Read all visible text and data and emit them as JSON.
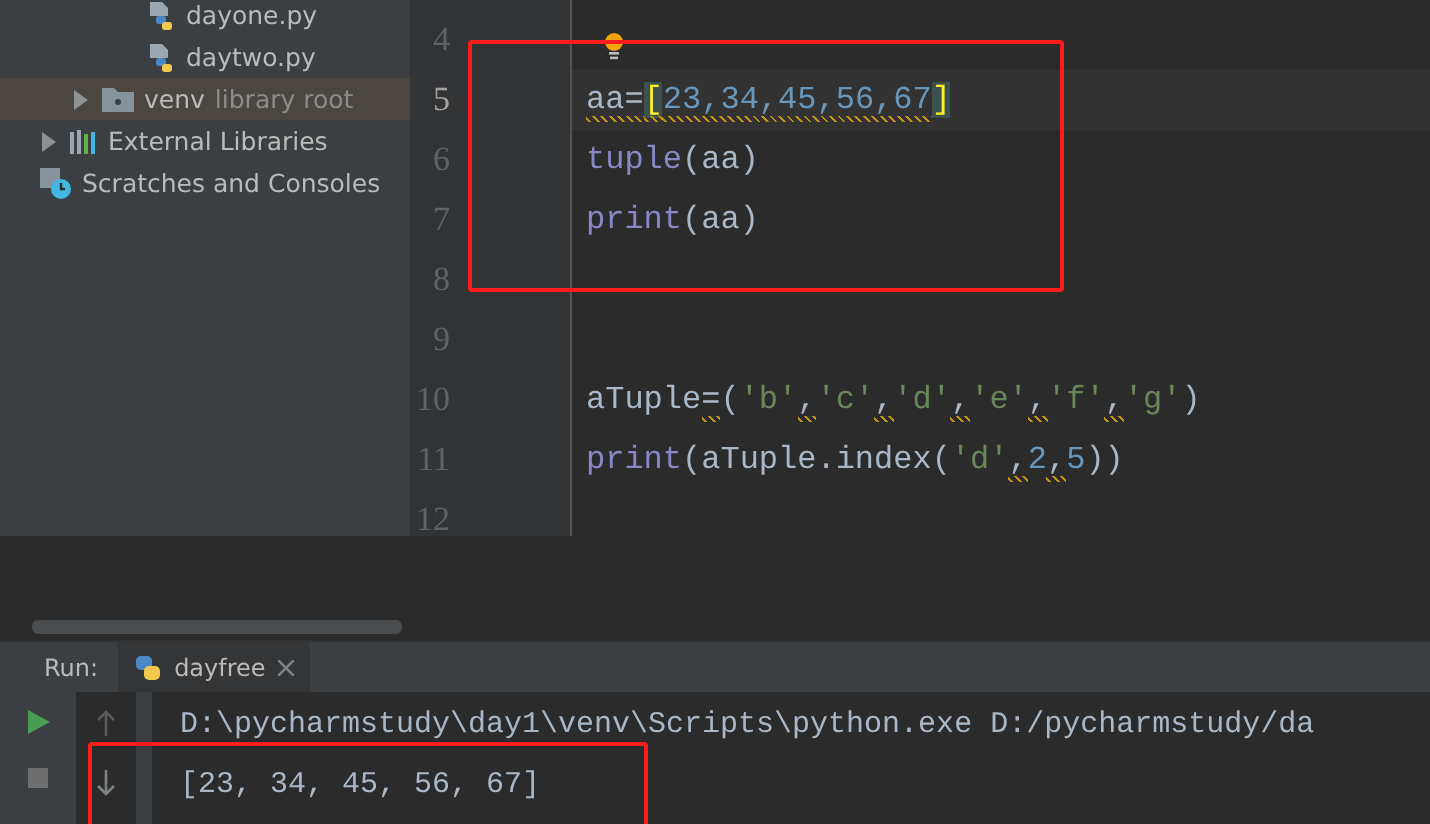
{
  "project_tree": {
    "items": [
      {
        "label": "dayone.py",
        "kind": "python-file",
        "selected": false
      },
      {
        "label": "daytwo.py",
        "kind": "python-file",
        "selected": false
      },
      {
        "label": "venv",
        "suffix": "library root",
        "kind": "folder",
        "selected": true,
        "expanded": false
      },
      {
        "label": "External Libraries",
        "kind": "libraries",
        "selected": false,
        "expanded": false
      },
      {
        "label": "Scratches and Consoles",
        "kind": "scratches",
        "selected": false
      }
    ]
  },
  "editor": {
    "lines": [
      {
        "number": "4",
        "current": false,
        "highlighted": false,
        "intention_bulb": true
      },
      {
        "number": "5",
        "current": true,
        "highlighted": true,
        "tokens": [
          {
            "text": "aa=",
            "kind": "plain",
            "warning": true
          },
          {
            "text": "[",
            "kind": "bracket-match",
            "warning": true
          },
          {
            "text": "23,34,45,56,67",
            "kind": "number",
            "warning": true
          },
          {
            "text": "]",
            "kind": "bracket-match"
          }
        ]
      },
      {
        "number": "6",
        "current": false,
        "highlighted": true,
        "tokens": [
          {
            "text": "tuple",
            "kind": "builtin"
          },
          {
            "text": "(aa)",
            "kind": "plain"
          }
        ]
      },
      {
        "number": "7",
        "current": false,
        "highlighted": true,
        "tokens": [
          {
            "text": "print",
            "kind": "builtin"
          },
          {
            "text": "(aa)",
            "kind": "plain"
          }
        ]
      },
      {
        "number": "8",
        "current": false,
        "highlighted": true
      },
      {
        "number": "9",
        "current": false,
        "highlighted": false
      },
      {
        "number": "10",
        "current": false,
        "highlighted": false,
        "tokens": [
          {
            "text": "aTuple",
            "kind": "plain"
          },
          {
            "text": "=",
            "kind": "plain",
            "warning": true
          },
          {
            "text": "(",
            "kind": "plain"
          },
          {
            "text": "'b'",
            "kind": "string"
          },
          {
            "text": ",",
            "kind": "plain",
            "warning": true
          },
          {
            "text": "'c'",
            "kind": "string"
          },
          {
            "text": ",",
            "kind": "plain",
            "warning": true
          },
          {
            "text": "'d'",
            "kind": "string"
          },
          {
            "text": ",",
            "kind": "plain",
            "warning": true
          },
          {
            "text": "'e'",
            "kind": "string"
          },
          {
            "text": ",",
            "kind": "plain",
            "warning": true
          },
          {
            "text": "'f'",
            "kind": "string"
          },
          {
            "text": ",",
            "kind": "plain",
            "warning": true
          },
          {
            "text": "'g'",
            "kind": "string"
          },
          {
            "text": ")",
            "kind": "plain"
          }
        ]
      },
      {
        "number": "11",
        "current": false,
        "highlighted": false,
        "tokens": [
          {
            "text": "print",
            "kind": "builtin"
          },
          {
            "text": "(aTuple.index(",
            "kind": "plain"
          },
          {
            "text": "'d'",
            "kind": "string"
          },
          {
            "text": ",",
            "kind": "plain",
            "warning": true
          },
          {
            "text": "2",
            "kind": "number"
          },
          {
            "text": ",",
            "kind": "plain",
            "warning": true
          },
          {
            "text": "5",
            "kind": "number"
          },
          {
            "text": "))",
            "kind": "plain"
          }
        ]
      },
      {
        "number": "12",
        "current": false,
        "highlighted": false
      }
    ]
  },
  "run_panel": {
    "label": "Run:",
    "tabs": [
      {
        "label": "dayfree",
        "selected": true,
        "closable": true
      }
    ],
    "output": [
      {
        "text": "D:\\pycharmstudy\\day1\\venv\\Scripts\\python.exe D:/pycharmstudy/da",
        "highlighted": false
      },
      {
        "text": "[23, 34, 45, 56, 67]",
        "highlighted": true
      }
    ]
  }
}
